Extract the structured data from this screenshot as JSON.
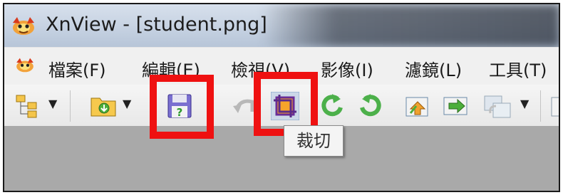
{
  "window": {
    "title": "XnView - [student.png]",
    "icon": "xnview-app-icon"
  },
  "menubar": {
    "icon": "xnview-menu-icon",
    "items": [
      {
        "label": "檔案(F)"
      },
      {
        "label": "編輯(E)"
      },
      {
        "label": "檢視(V)"
      },
      {
        "label": "影像(I)"
      },
      {
        "label": "濾鏡(L)"
      },
      {
        "label": "工具(T)"
      }
    ]
  },
  "toolbar": {
    "buttons": [
      {
        "name": "browser-tree-button",
        "icon": "folder-tree-icon"
      },
      {
        "name": "open-folder-button",
        "icon": "folder-open-icon"
      },
      {
        "name": "save-as-button",
        "icon": "floppy-disk-question-icon",
        "highlighted": true
      },
      {
        "name": "undo-button",
        "icon": "undo-arrow-icon"
      },
      {
        "name": "crop-button",
        "icon": "crop-icon",
        "highlighted": true
      },
      {
        "name": "rotate-left-button",
        "icon": "rotate-left-icon"
      },
      {
        "name": "rotate-right-button",
        "icon": "rotate-right-icon"
      },
      {
        "name": "previous-button",
        "icon": "arrow-up-icon"
      },
      {
        "name": "next-button",
        "icon": "arrow-right-icon"
      },
      {
        "name": "convert-button",
        "icon": "convert-icon"
      }
    ]
  },
  "tooltip": {
    "text": "裁切"
  },
  "colors": {
    "highlight": "#ef1111",
    "workspace": "#a9a9a9"
  }
}
